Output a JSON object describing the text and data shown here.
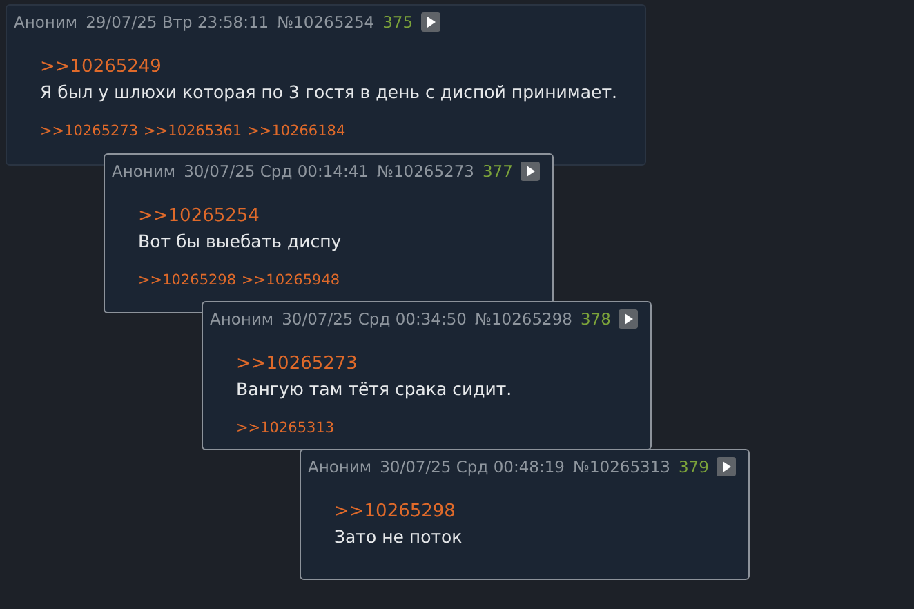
{
  "posts": [
    {
      "popup": false,
      "name": "Аноним",
      "date": "29/07/25 Втр 23:58:11",
      "number": "№10265254",
      "count": "375",
      "quote": ">>10265249",
      "text": "Я был у шлюхи которая по 3 гостя в день с диспой принимает.",
      "replies": [
        ">>10265273",
        ">>10265361",
        ">>10266184"
      ]
    },
    {
      "popup": true,
      "name": "Аноним",
      "date": "30/07/25 Срд 00:14:41",
      "number": "№10265273",
      "count": "377",
      "quote": ">>10265254",
      "text": "Вот бы выебать диспу",
      "replies": [
        ">>10265298",
        ">>10265948"
      ]
    },
    {
      "popup": true,
      "name": "Аноним",
      "date": "30/07/25 Срд 00:34:50",
      "number": "№10265298",
      "count": "378",
      "quote": ">>10265273",
      "text": "Вангую там тётя срака сидит.",
      "replies": [
        ">>10265313"
      ]
    },
    {
      "popup": true,
      "name": "Аноним",
      "date": "30/07/25 Срд 00:48:19",
      "number": "№10265313",
      "count": "379",
      "quote": ">>10265298",
      "text": "Зато не поток"
    }
  ]
}
